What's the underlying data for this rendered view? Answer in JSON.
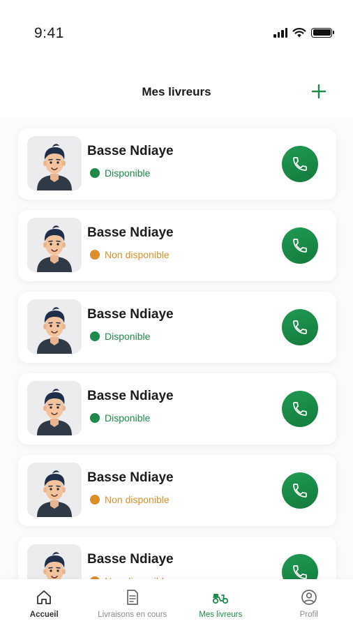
{
  "status_bar": {
    "time": "9:41"
  },
  "header": {
    "title": "Mes livreurs",
    "add_icon": "plus-icon"
  },
  "colors": {
    "accent": "#1f8a4c",
    "available": "#1f8a4c",
    "unavailable": "#d98f2b"
  },
  "drivers": [
    {
      "name": "Basse Ndiaye",
      "status": "Disponible",
      "available": true
    },
    {
      "name": "Basse Ndiaye",
      "status": "Non disponible",
      "available": false
    },
    {
      "name": "Basse Ndiaye",
      "status": "Disponible",
      "available": true
    },
    {
      "name": "Basse Ndiaye",
      "status": "Disponible",
      "available": true
    },
    {
      "name": "Basse Ndiaye",
      "status": "Non disponible",
      "available": false
    },
    {
      "name": "Basse Ndiaye",
      "status": "Non disponible",
      "available": false
    }
  ],
  "nav": {
    "items": [
      {
        "label": "Accueil",
        "icon": "home-icon"
      },
      {
        "label": "Livraisons en cours",
        "icon": "document-icon"
      },
      {
        "label": "Mes livreurs",
        "icon": "scooter-icon"
      },
      {
        "label": "Profil",
        "icon": "user-circle-icon"
      }
    ]
  }
}
